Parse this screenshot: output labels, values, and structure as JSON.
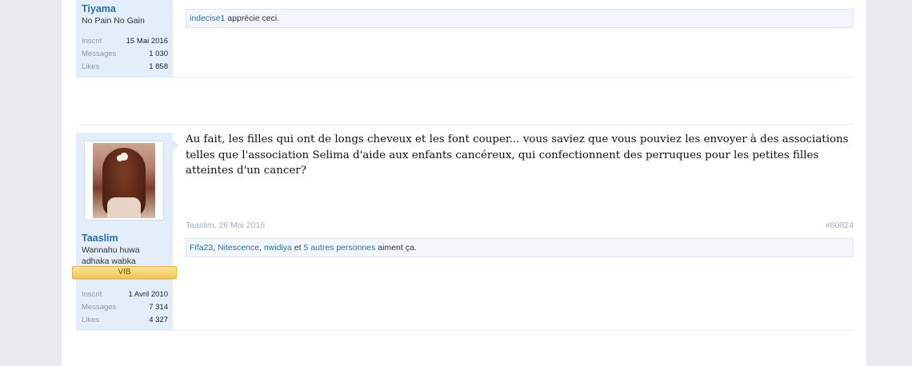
{
  "posts": [
    {
      "username": "Tiyama",
      "user_title": "No Pain No Gain",
      "stats": [
        {
          "key": "Inscrit",
          "value": "15 Mai 2016"
        },
        {
          "key": "Messages",
          "value": "1 030"
        },
        {
          "key": "Likes",
          "value": "1 858"
        }
      ],
      "likes": {
        "users": [
          "indecise1"
        ],
        "suffix": "apprécie ceci."
      }
    },
    {
      "username": "Taaslim",
      "user_title": "Wannahu huwa adhaka wabka",
      "badge": "VIB",
      "stats": [
        {
          "key": "Inscrit",
          "value": "1 Avril 2010"
        },
        {
          "key": "Messages",
          "value": "7 314"
        },
        {
          "key": "Likes",
          "value": "4 327"
        }
      ],
      "message": "Au fait, les filles qui ont de longs cheveux et les font couper... vous saviez que vous pouviez les envoyer à des associations telles que l'association Selima d'aide aux enfants cancéreux, qui confectionnent des perruques pour les petites filles atteintes d'un cancer?",
      "meta": {
        "author": "Taaslim",
        "date": "26 Mai 2016",
        "post_number": "#80824"
      },
      "likes": {
        "users": [
          "Fifa23",
          "Nitescence",
          "nwidiya"
        ],
        "others": "5 autres personnes",
        "separator": ", ",
        "and": "et",
        "suffix": "aiment ça."
      }
    }
  ],
  "colors": {
    "link": "#2b6fa6",
    "user_bg": "#e4eefa",
    "badge": "#f3c655",
    "page_bg": "#e7eaef"
  }
}
